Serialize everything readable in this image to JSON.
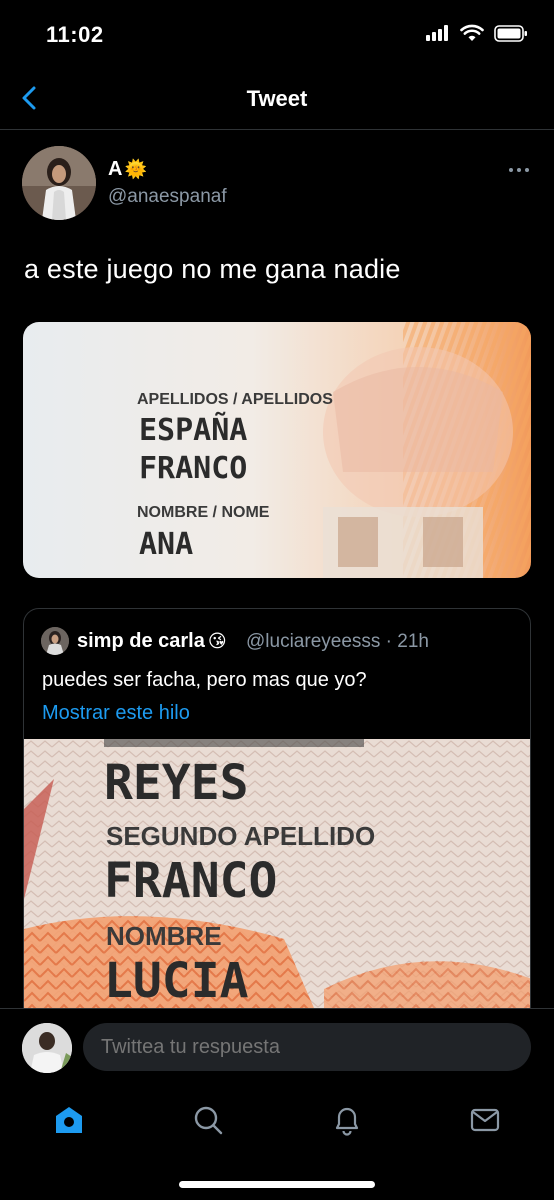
{
  "status_bar": {
    "time": "11:02"
  },
  "nav": {
    "title": "Tweet"
  },
  "tweet": {
    "author_name": "A",
    "author_emoji": "🌞",
    "handle": "@anaespanaf",
    "text": "a este juego no me gana nadie",
    "media": {
      "label_surnames": "APELLIDOS / APELLIDOS",
      "surname_1": "ESPAÑA",
      "surname_2": "FRANCO",
      "label_name": "NOMBRE / NOME",
      "name": "ANA"
    }
  },
  "quoted_tweet": {
    "author_name": "simp de carla",
    "author_emoji": "😘",
    "handle": "@luciareyeesss · 21h",
    "text": "puedes ser facha, pero mas que yo?",
    "link": "Mostrar este hilo",
    "media": {
      "surname_1": "REYES",
      "label_second_surname": "SEGUNDO APELLIDO",
      "surname_2": "FRANCO",
      "label_name": "NOMBRE",
      "name": "LUCIA"
    }
  },
  "reply": {
    "placeholder": "Twittea tu respuesta"
  },
  "tabs": [
    "home-icon",
    "search-icon",
    "notifications-icon",
    "messages-icon"
  ],
  "colors": {
    "accent": "#1d9bf0",
    "background": "#000000",
    "secondary_text": "#8b98a5",
    "border": "#2f3336"
  }
}
